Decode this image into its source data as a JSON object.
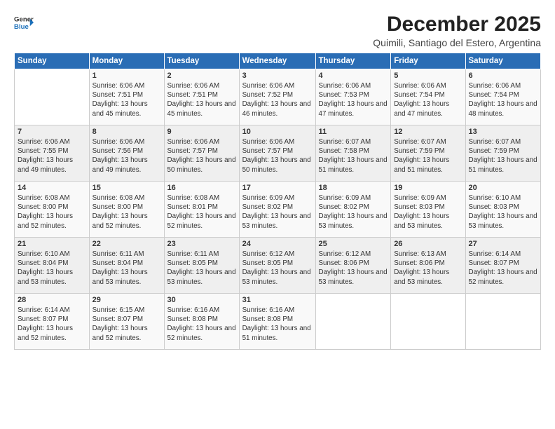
{
  "logo": {
    "line1": "General",
    "line2": "Blue"
  },
  "title": "December 2025",
  "subtitle": "Quimili, Santiago del Estero, Argentina",
  "header": {
    "colors": {
      "accent": "#2a6db5"
    }
  },
  "weekdays": [
    "Sunday",
    "Monday",
    "Tuesday",
    "Wednesday",
    "Thursday",
    "Friday",
    "Saturday"
  ],
  "weeks": [
    [
      {
        "day": "",
        "sunrise": "",
        "sunset": "",
        "daylight": ""
      },
      {
        "day": "1",
        "sunrise": "Sunrise: 6:06 AM",
        "sunset": "Sunset: 7:51 PM",
        "daylight": "Daylight: 13 hours and 45 minutes."
      },
      {
        "day": "2",
        "sunrise": "Sunrise: 6:06 AM",
        "sunset": "Sunset: 7:51 PM",
        "daylight": "Daylight: 13 hours and 45 minutes."
      },
      {
        "day": "3",
        "sunrise": "Sunrise: 6:06 AM",
        "sunset": "Sunset: 7:52 PM",
        "daylight": "Daylight: 13 hours and 46 minutes."
      },
      {
        "day": "4",
        "sunrise": "Sunrise: 6:06 AM",
        "sunset": "Sunset: 7:53 PM",
        "daylight": "Daylight: 13 hours and 47 minutes."
      },
      {
        "day": "5",
        "sunrise": "Sunrise: 6:06 AM",
        "sunset": "Sunset: 7:54 PM",
        "daylight": "Daylight: 13 hours and 47 minutes."
      },
      {
        "day": "6",
        "sunrise": "Sunrise: 6:06 AM",
        "sunset": "Sunset: 7:54 PM",
        "daylight": "Daylight: 13 hours and 48 minutes."
      }
    ],
    [
      {
        "day": "7",
        "sunrise": "Sunrise: 6:06 AM",
        "sunset": "Sunset: 7:55 PM",
        "daylight": "Daylight: 13 hours and 49 minutes."
      },
      {
        "day": "8",
        "sunrise": "Sunrise: 6:06 AM",
        "sunset": "Sunset: 7:56 PM",
        "daylight": "Daylight: 13 hours and 49 minutes."
      },
      {
        "day": "9",
        "sunrise": "Sunrise: 6:06 AM",
        "sunset": "Sunset: 7:57 PM",
        "daylight": "Daylight: 13 hours and 50 minutes."
      },
      {
        "day": "10",
        "sunrise": "Sunrise: 6:06 AM",
        "sunset": "Sunset: 7:57 PM",
        "daylight": "Daylight: 13 hours and 50 minutes."
      },
      {
        "day": "11",
        "sunrise": "Sunrise: 6:07 AM",
        "sunset": "Sunset: 7:58 PM",
        "daylight": "Daylight: 13 hours and 51 minutes."
      },
      {
        "day": "12",
        "sunrise": "Sunrise: 6:07 AM",
        "sunset": "Sunset: 7:59 PM",
        "daylight": "Daylight: 13 hours and 51 minutes."
      },
      {
        "day": "13",
        "sunrise": "Sunrise: 6:07 AM",
        "sunset": "Sunset: 7:59 PM",
        "daylight": "Daylight: 13 hours and 51 minutes."
      }
    ],
    [
      {
        "day": "14",
        "sunrise": "Sunrise: 6:08 AM",
        "sunset": "Sunset: 8:00 PM",
        "daylight": "Daylight: 13 hours and 52 minutes."
      },
      {
        "day": "15",
        "sunrise": "Sunrise: 6:08 AM",
        "sunset": "Sunset: 8:00 PM",
        "daylight": "Daylight: 13 hours and 52 minutes."
      },
      {
        "day": "16",
        "sunrise": "Sunrise: 6:08 AM",
        "sunset": "Sunset: 8:01 PM",
        "daylight": "Daylight: 13 hours and 52 minutes."
      },
      {
        "day": "17",
        "sunrise": "Sunrise: 6:09 AM",
        "sunset": "Sunset: 8:02 PM",
        "daylight": "Daylight: 13 hours and 53 minutes."
      },
      {
        "day": "18",
        "sunrise": "Sunrise: 6:09 AM",
        "sunset": "Sunset: 8:02 PM",
        "daylight": "Daylight: 13 hours and 53 minutes."
      },
      {
        "day": "19",
        "sunrise": "Sunrise: 6:09 AM",
        "sunset": "Sunset: 8:03 PM",
        "daylight": "Daylight: 13 hours and 53 minutes."
      },
      {
        "day": "20",
        "sunrise": "Sunrise: 6:10 AM",
        "sunset": "Sunset: 8:03 PM",
        "daylight": "Daylight: 13 hours and 53 minutes."
      }
    ],
    [
      {
        "day": "21",
        "sunrise": "Sunrise: 6:10 AM",
        "sunset": "Sunset: 8:04 PM",
        "daylight": "Daylight: 13 hours and 53 minutes."
      },
      {
        "day": "22",
        "sunrise": "Sunrise: 6:11 AM",
        "sunset": "Sunset: 8:04 PM",
        "daylight": "Daylight: 13 hours and 53 minutes."
      },
      {
        "day": "23",
        "sunrise": "Sunrise: 6:11 AM",
        "sunset": "Sunset: 8:05 PM",
        "daylight": "Daylight: 13 hours and 53 minutes."
      },
      {
        "day": "24",
        "sunrise": "Sunrise: 6:12 AM",
        "sunset": "Sunset: 8:05 PM",
        "daylight": "Daylight: 13 hours and 53 minutes."
      },
      {
        "day": "25",
        "sunrise": "Sunrise: 6:12 AM",
        "sunset": "Sunset: 8:06 PM",
        "daylight": "Daylight: 13 hours and 53 minutes."
      },
      {
        "day": "26",
        "sunrise": "Sunrise: 6:13 AM",
        "sunset": "Sunset: 8:06 PM",
        "daylight": "Daylight: 13 hours and 53 minutes."
      },
      {
        "day": "27",
        "sunrise": "Sunrise: 6:14 AM",
        "sunset": "Sunset: 8:07 PM",
        "daylight": "Daylight: 13 hours and 52 minutes."
      }
    ],
    [
      {
        "day": "28",
        "sunrise": "Sunrise: 6:14 AM",
        "sunset": "Sunset: 8:07 PM",
        "daylight": "Daylight: 13 hours and 52 minutes."
      },
      {
        "day": "29",
        "sunrise": "Sunrise: 6:15 AM",
        "sunset": "Sunset: 8:07 PM",
        "daylight": "Daylight: 13 hours and 52 minutes."
      },
      {
        "day": "30",
        "sunrise": "Sunrise: 6:16 AM",
        "sunset": "Sunset: 8:08 PM",
        "daylight": "Daylight: 13 hours and 52 minutes."
      },
      {
        "day": "31",
        "sunrise": "Sunrise: 6:16 AM",
        "sunset": "Sunset: 8:08 PM",
        "daylight": "Daylight: 13 hours and 51 minutes."
      },
      {
        "day": "",
        "sunrise": "",
        "sunset": "",
        "daylight": ""
      },
      {
        "day": "",
        "sunrise": "",
        "sunset": "",
        "daylight": ""
      },
      {
        "day": "",
        "sunrise": "",
        "sunset": "",
        "daylight": ""
      }
    ]
  ]
}
